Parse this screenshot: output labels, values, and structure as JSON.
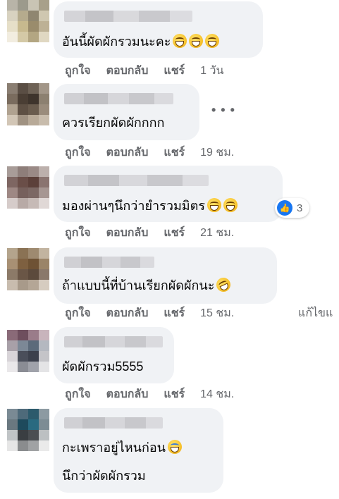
{
  "actions": {
    "like": "ถูกใจ",
    "reply": "ตอบกลับ",
    "share": "แชร์",
    "edit": "แก้ไขแ"
  },
  "more_icon": "more-options-icon",
  "comments": [
    {
      "lines": [
        "อันนี้ผัดผักรวมนะคะ"
      ],
      "emojis": [
        "grin-icon",
        "grin-icon",
        "grin-icon"
      ],
      "time": "1 วัน"
    },
    {
      "lines": [
        "ควรเรียกผัดผักกกก"
      ],
      "time": "19 ชม."
    },
    {
      "lines": [
        "มองผ่านๆนึกว่ายำรวมมิตร"
      ],
      "emojis": [
        "grin-icon",
        "grin-icon"
      ],
      "reaction_icon": "like-icon",
      "reaction_count": "3",
      "time": "21 ชม."
    },
    {
      "lines": [
        "ถ้าแบบนี้ที่บ้านเรียกผัดผักนะ"
      ],
      "emojis": [
        "rofl-icon"
      ],
      "time": "15 ชม."
    },
    {
      "lines": [
        "ผัดผักรวม5555"
      ],
      "time": "14 ชม."
    },
    {
      "lines": [
        "กะเพราอยู่ไหนก่อน",
        "นึกว่าผัดผักรวม"
      ],
      "emojis": [
        "laugh-cry-icon"
      ]
    }
  ]
}
